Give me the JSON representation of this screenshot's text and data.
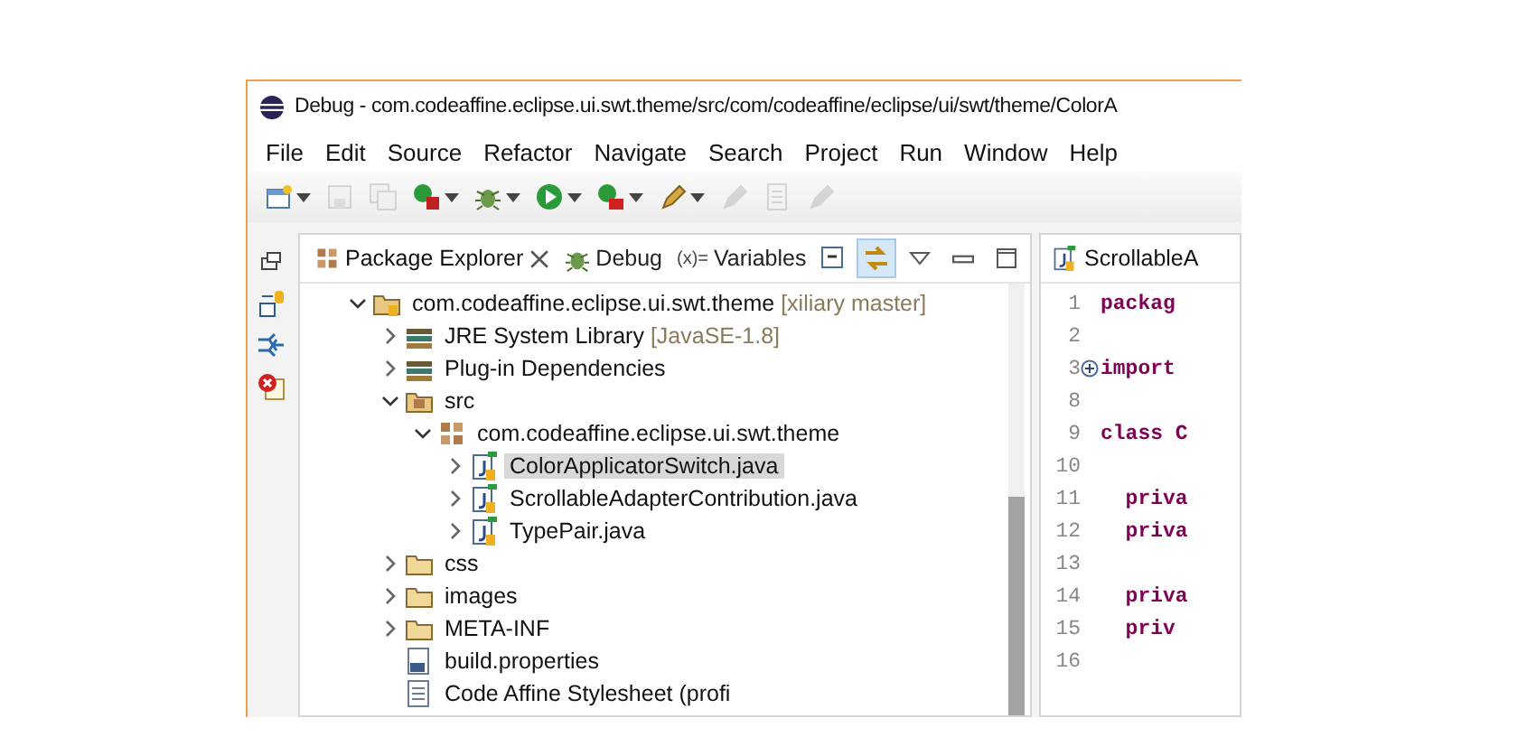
{
  "window": {
    "title": "Debug - com.codeaffine.eclipse.ui.swt.theme/src/com/codeaffine/eclipse/ui/swt/theme/ColorA"
  },
  "menu": [
    "File",
    "Edit",
    "Source",
    "Refactor",
    "Navigate",
    "Search",
    "Project",
    "Run",
    "Window",
    "Help"
  ],
  "toolbar": [
    {
      "kind": "new",
      "disabled": false,
      "dropdown": true
    },
    {
      "kind": "save",
      "disabled": true,
      "dropdown": false
    },
    {
      "kind": "save-all",
      "disabled": true,
      "dropdown": false
    },
    {
      "kind": "coverage",
      "disabled": false,
      "dropdown": true
    },
    {
      "kind": "debug",
      "disabled": false,
      "dropdown": true
    },
    {
      "kind": "run",
      "disabled": false,
      "dropdown": true
    },
    {
      "kind": "external",
      "disabled": false,
      "dropdown": true
    },
    {
      "kind": "pen",
      "disabled": false,
      "dropdown": true
    },
    {
      "kind": "pen",
      "disabled": true,
      "dropdown": false
    },
    {
      "kind": "page",
      "disabled": true,
      "dropdown": false
    },
    {
      "kind": "pen",
      "disabled": true,
      "dropdown": false
    }
  ],
  "trim": [
    {
      "kind": "restore"
    },
    {
      "kind": "hierarchy"
    },
    {
      "kind": "branches"
    },
    {
      "kind": "error-log"
    }
  ],
  "view_tabs": [
    {
      "label": "Package Explorer",
      "kind": "package",
      "selected": true
    },
    {
      "label": "Debug",
      "kind": "bug",
      "selected": false
    },
    {
      "label": "Variables",
      "kind": "variables",
      "icon_text": "(x)=",
      "selected": false
    }
  ],
  "view_actions": [
    {
      "kind": "collapse",
      "on": false
    },
    {
      "kind": "link",
      "on": true
    },
    {
      "kind": "menu",
      "on": false
    },
    {
      "kind": "minimize",
      "on": false
    },
    {
      "kind": "maximize",
      "on": false
    }
  ],
  "tree": [
    {
      "label": "com.codeaffine.eclipse.ui.swt.theme",
      "decoration": "[xiliary master]",
      "kind": "project",
      "expanded": true,
      "selected": false,
      "children": [
        {
          "label": "JRE System Library",
          "decoration": "[JavaSE-1.8]",
          "kind": "library",
          "expanded": false,
          "selected": false
        },
        {
          "label": "Plug-in Dependencies",
          "kind": "library",
          "expanded": false,
          "selected": false
        },
        {
          "label": "src",
          "kind": "source-folder",
          "expanded": true,
          "selected": false,
          "children": [
            {
              "label": "com.codeaffine.eclipse.ui.swt.theme",
              "kind": "package",
              "expanded": true,
              "selected": false,
              "children": [
                {
                  "label": "ColorApplicatorSwitch.java",
                  "kind": "java",
                  "expanded": false,
                  "selected": true
                },
                {
                  "label": "ScrollableAdapterContribution.java",
                  "kind": "java",
                  "expanded": false,
                  "selected": false
                },
                {
                  "label": "TypePair.java",
                  "kind": "java",
                  "expanded": false,
                  "selected": false
                }
              ]
            }
          ]
        },
        {
          "label": "css",
          "kind": "folder",
          "expanded": false,
          "selected": false
        },
        {
          "label": "images",
          "kind": "folder",
          "expanded": false,
          "selected": false
        },
        {
          "label": "META-INF",
          "kind": "folder",
          "expanded": false,
          "selected": false
        },
        {
          "label": "build.properties",
          "kind": "properties",
          "selected": false
        },
        {
          "label": "Code Affine Stylesheet (profi",
          "kind": "file",
          "selected": false
        }
      ]
    }
  ],
  "editor": {
    "tab": "ScrollableA",
    "lines": [
      {
        "number": "1",
        "text": "packag",
        "folded": false
      },
      {
        "number": "2",
        "folded": false
      },
      {
        "number": "3",
        "text": "import",
        "folded": true
      },
      {
        "number": "8",
        "folded": false
      },
      {
        "number": "9",
        "text": "class C",
        "folded": false
      },
      {
        "number": "10",
        "folded": false
      },
      {
        "number": "11",
        "text": "  priva",
        "folded": false
      },
      {
        "number": "12",
        "text": "  priva",
        "folded": false
      },
      {
        "number": "13",
        "folded": false
      },
      {
        "number": "14",
        "text": "  priva",
        "folded": false
      },
      {
        "number": "15",
        "text": "  priv",
        "folded": false
      },
      {
        "number": "16",
        "folded": false
      }
    ]
  }
}
